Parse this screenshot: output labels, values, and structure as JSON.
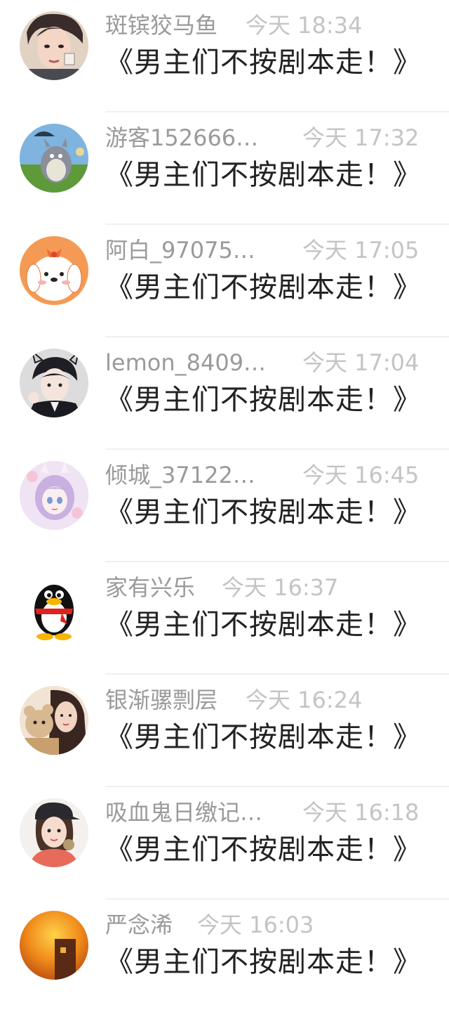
{
  "comments": [
    {
      "name": "斑镔狡马鱼",
      "time": "今天 18:34",
      "title": "《男主们不按剧本走！》",
      "avatar_icon": "avatar-boy-photo",
      "avatar_color": "#3a2c2a"
    },
    {
      "name": "游客152666…",
      "time": "今天 17:32",
      "title": "《男主们不按剧本走！》",
      "avatar_icon": "avatar-totoro",
      "avatar_color": "#5e9a3a"
    },
    {
      "name": "阿白_97075…",
      "time": "今天 17:05",
      "title": "《男主们不按剧本走！》",
      "avatar_icon": "avatar-cartoon-dog",
      "avatar_color": "#f59a54"
    },
    {
      "name": "lemon_8409…",
      "time": "今天 17:04",
      "title": "《男主们不按剧本走！》",
      "avatar_icon": "avatar-anime-boy",
      "avatar_color": "#dcdcdc"
    },
    {
      "name": "倾城_37122…",
      "time": "今天 16:45",
      "title": "《男主们不按剧本走！》",
      "avatar_icon": "avatar-anime-girl",
      "avatar_color": "#efe3f4"
    },
    {
      "name": "家有兴乐",
      "time": "今天 16:37",
      "title": "《男主们不按剧本走！》",
      "avatar_icon": "avatar-qq-penguin",
      "avatar_color": "#ffffff"
    },
    {
      "name": "银渐骡剽层",
      "time": "今天 16:24",
      "title": "《男主们不按剧本走！》",
      "avatar_icon": "avatar-girl-bear-photo",
      "avatar_color": "#f1e4d4"
    },
    {
      "name": "吸血鬼日缴记…",
      "time": "今天 16:18",
      "title": "《男主们不按剧本走！》",
      "avatar_icon": "avatar-girl-cap-photo",
      "avatar_color": "#f3f0ee"
    },
    {
      "name": "严念浠",
      "time": "今天 16:03",
      "title": "《男主们不按剧本走！》",
      "avatar_icon": "avatar-sunset-photo",
      "avatar_color": "#e8730f"
    }
  ]
}
